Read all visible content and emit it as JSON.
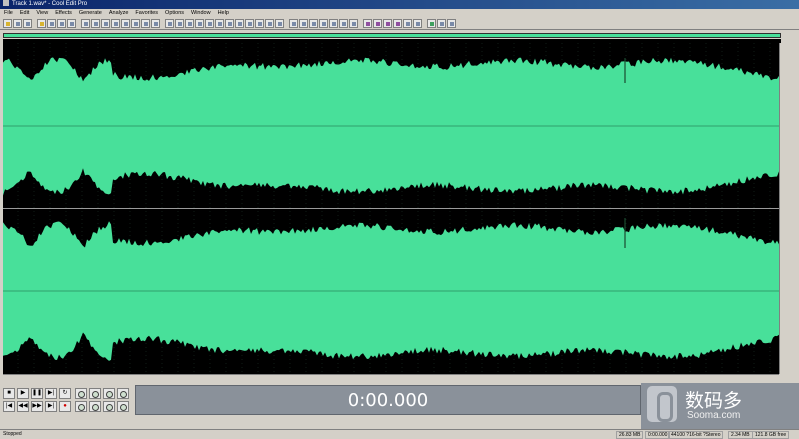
{
  "window": {
    "title": "Track 1.wav* - Cool Edit Pro"
  },
  "menu": [
    "File",
    "Edit",
    "View",
    "Effects",
    "Generate",
    "Analyze",
    "Favorites",
    "Options",
    "Window",
    "Help"
  ],
  "time_display": "0:00.000",
  "status": {
    "state": "Stopped",
    "sample_rate_info": "44100 ?16-bit ?Stereo",
    "cells": [
      "26.83 MB",
      "0:00.000",
      "2.34 MB",
      "121.8 GB free"
    ]
  },
  "watermark": {
    "cn": "数码多",
    "en": "Sooma.com"
  },
  "colors": {
    "waveform": "#48e09a",
    "background": "#000000",
    "timedisplay": "#8a919a"
  },
  "transport": [
    "stop-icon",
    "play-icon",
    "pause-icon",
    "play-to-end-icon",
    "loop-icon",
    "go-start-icon",
    "rewind-icon",
    "forward-icon",
    "go-end-icon",
    "record-icon"
  ]
}
